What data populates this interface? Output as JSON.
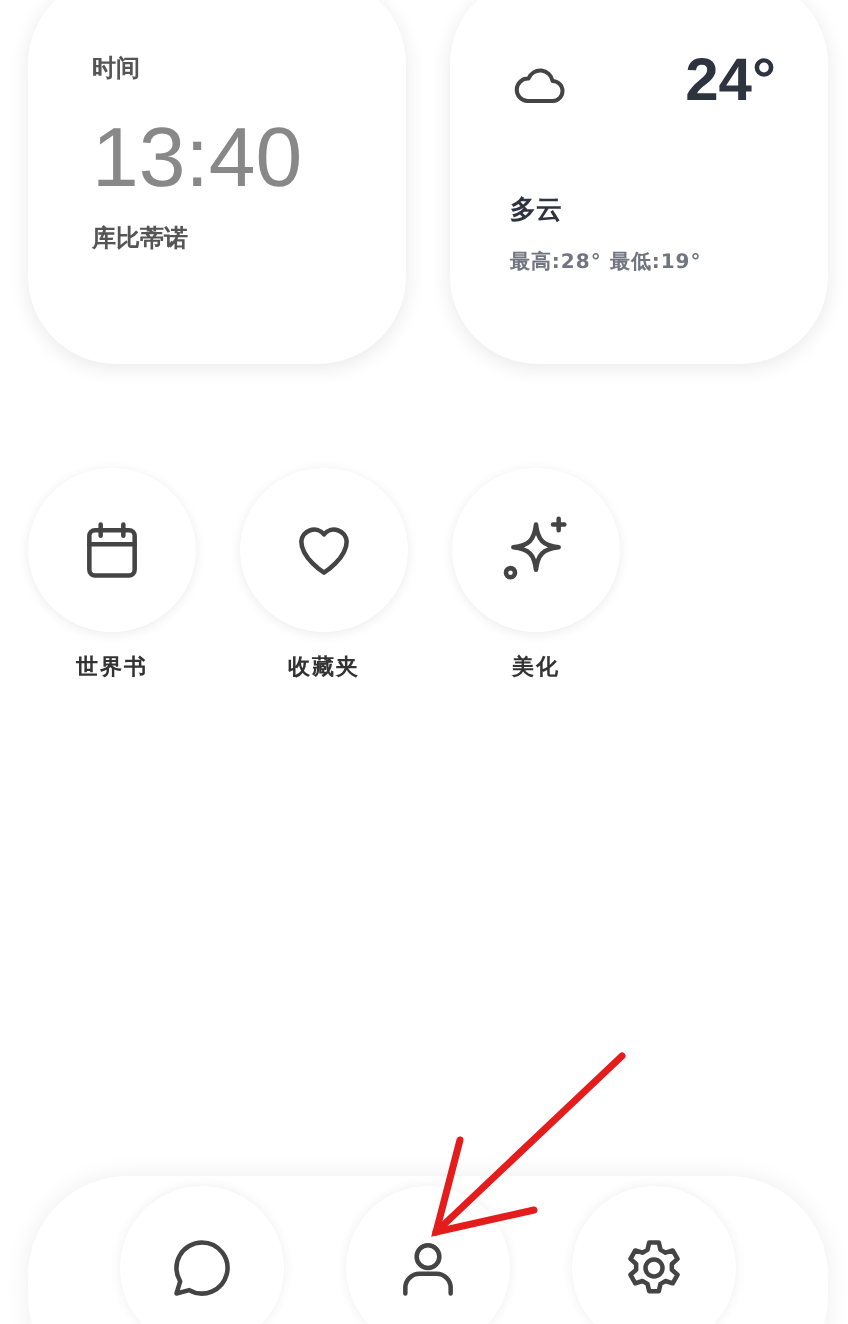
{
  "time_widget": {
    "label": "时间",
    "time": "13:40",
    "location": "库比蒂诺"
  },
  "weather_widget": {
    "kind": "cloud",
    "temperature": "24°",
    "condition": "多云",
    "range": "最高:28° 最低:19°"
  },
  "apps": [
    {
      "kind": "calendar",
      "label": "世界书"
    },
    {
      "kind": "heart",
      "label": "收藏夹"
    },
    {
      "kind": "sparkle",
      "label": "美化"
    }
  ],
  "dock": [
    {
      "kind": "chat"
    },
    {
      "kind": "person"
    },
    {
      "kind": "gear"
    }
  ]
}
